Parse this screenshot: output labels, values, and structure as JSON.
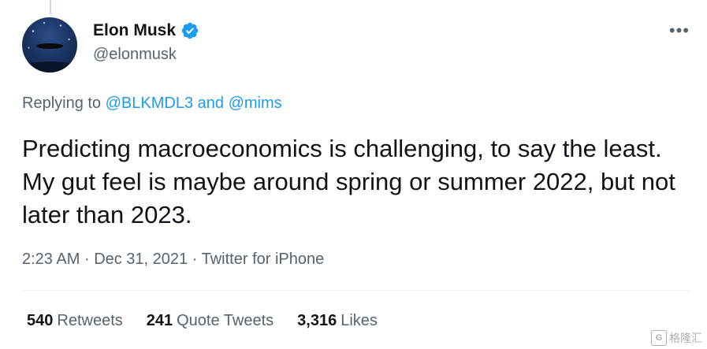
{
  "author": {
    "display_name": "Elon Musk",
    "handle": "@elonmusk",
    "verified": true,
    "avatar_icon": "avatar-image"
  },
  "more_icon": "more-options-icon",
  "reply_context": {
    "prefix": "Replying to",
    "mention_1": "@BLKMDL3",
    "conjunction": "and",
    "mention_2": "@mims"
  },
  "tweet": {
    "text": "Predicting macroeconomics is challenging, to say the least. My gut feel is maybe around spring or summer 2022, but not later than 2023."
  },
  "meta": {
    "time": "2:23 AM",
    "separator_1": "·",
    "date": "Dec 31, 2021",
    "separator_2": "·",
    "source": "Twitter for iPhone"
  },
  "stats": {
    "retweets_count": "540",
    "retweets_label": "Retweets",
    "quotes_count": "241",
    "quotes_label": "Quote Tweets",
    "likes_count": "3,316",
    "likes_label": "Likes"
  },
  "watermark": {
    "text": "格隆汇"
  },
  "colors": {
    "accent": "#1d9bf0",
    "text_primary": "#0f1419",
    "text_secondary": "#536471"
  }
}
